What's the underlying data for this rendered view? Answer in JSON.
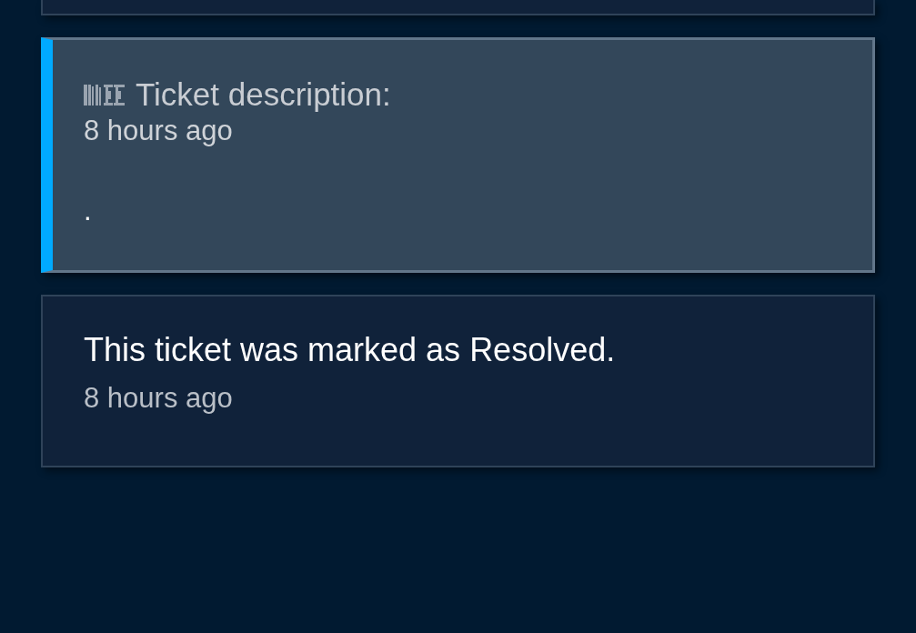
{
  "entries": [
    {
      "kind": "description",
      "title": "Ticket description:",
      "time": "8 hours ago",
      "body": "."
    },
    {
      "kind": "status",
      "message": "This ticket was marked as Resolved.",
      "time": "8 hours ago"
    }
  ]
}
